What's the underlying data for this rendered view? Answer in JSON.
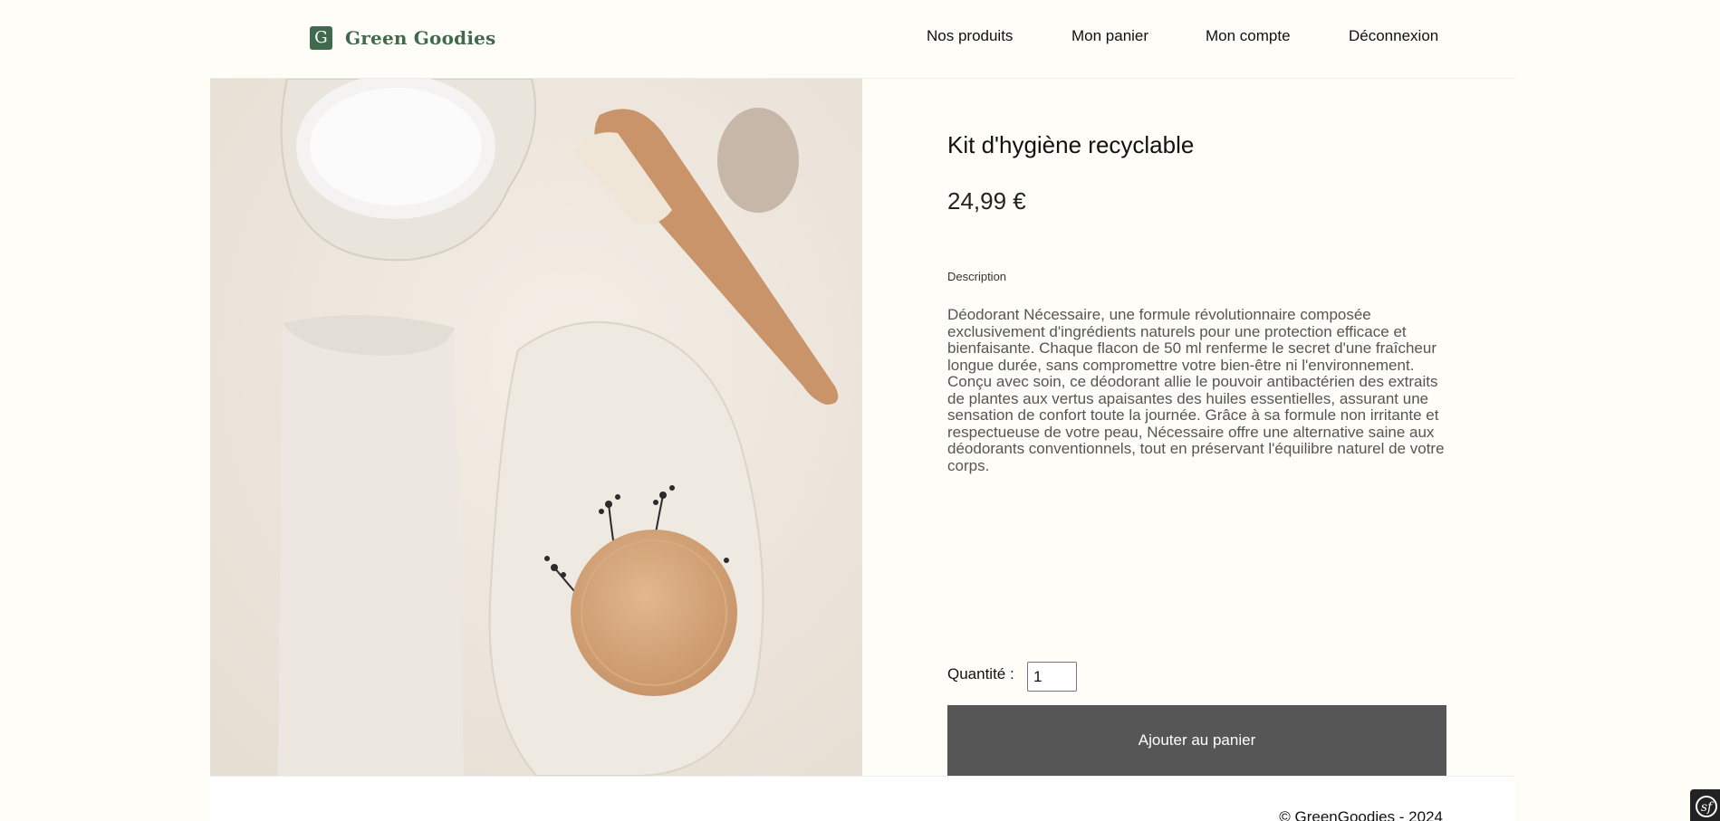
{
  "header": {
    "logo_letter": "G",
    "logo_text": "Green Goodies",
    "nav": {
      "products": "Nos produits",
      "cart": "Mon panier",
      "account": "Mon compte",
      "logout": "Déconnexion"
    }
  },
  "product": {
    "image_alt": "Kit d'hygiène recyclable",
    "title": "Kit d'hygiène recyclable",
    "price": "24,99 €",
    "description_label": "Description",
    "description": "Déodorant Nécessaire, une formule révolutionnaire composée exclusivement d'ingrédients naturels pour une protection efficace et bienfaisante. Chaque flacon de 50 ml renferme le secret d'une fraîcheur longue durée, sans compromettre votre bien-être ni l'environnement. Conçu avec soin, ce déodorant allie le pouvoir antibactérien des extraits de plantes aux vertus apaisantes des huiles essentielles, assurant une sensation de confort toute la journée. Grâce à sa formule non irritante et respectueuse de votre peau, Nécessaire offre une alternative saine aux déodorants conventionnels, tout en préservant l'équilibre naturel de votre corps.",
    "quantity_label": "Quantité :",
    "quantity_value": "1",
    "add_to_cart": "Ajouter au panier"
  },
  "footer": {
    "copyright": "© GreenGoodies - 2024"
  },
  "colors": {
    "background": "#fefdf7",
    "brand": "#40694e",
    "button": "#565656"
  },
  "icons": {
    "logo": "logo-g-icon",
    "debug_toolbar": "symfony-icon"
  }
}
